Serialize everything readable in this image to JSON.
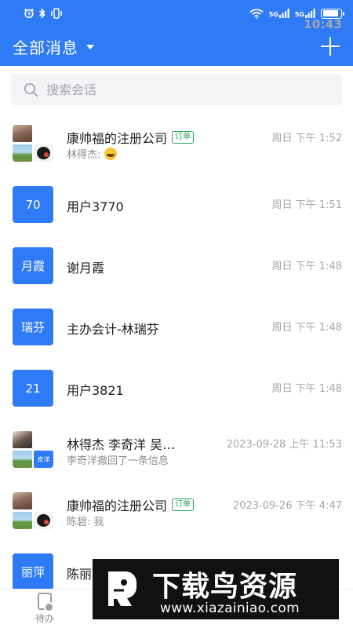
{
  "status_bar": {
    "time": "10:43",
    "network_1": "5G",
    "network_2": "5G"
  },
  "header": {
    "title": "全部消息"
  },
  "search": {
    "placeholder": "搜索会话"
  },
  "conversations": [
    {
      "avatar": "",
      "name": "康帅福的注册公司",
      "tag": "订单",
      "preview": "林得杰: ",
      "time": "周日 下午 1:52"
    },
    {
      "avatar": "70",
      "name": "用户3770",
      "time": "周日 下午 1:51"
    },
    {
      "avatar": "月霞",
      "name": "谢月霞",
      "time": "周日 下午 1:48"
    },
    {
      "avatar": "瑞芬",
      "name": "主办会计-林瑞芬",
      "time": "周日 下午 1:48"
    },
    {
      "avatar": "21",
      "name": "用户3821",
      "time": "周日 下午 1:48"
    },
    {
      "avatar_tile": "奇洋",
      "name": "林得杰 李奇洋 吴…",
      "preview": "李奇洋撤回了一条信息",
      "time": "2023-09-28 上午 11:53"
    },
    {
      "name": "康帅福的注册公司",
      "tag": "订单",
      "preview": "陈碧: 我",
      "time": "2023-09-26 下午 4:47"
    },
    {
      "avatar": "丽萍",
      "name": "陈丽",
      "time": ""
    }
  ],
  "tabbar": {
    "todo_label": "待办"
  },
  "watermark": {
    "title": "下载鸟资源",
    "url": "www.xiazainiao.com"
  },
  "colors": {
    "brand_blue": "#2f7bf5",
    "tag_green": "#2aa65b"
  }
}
